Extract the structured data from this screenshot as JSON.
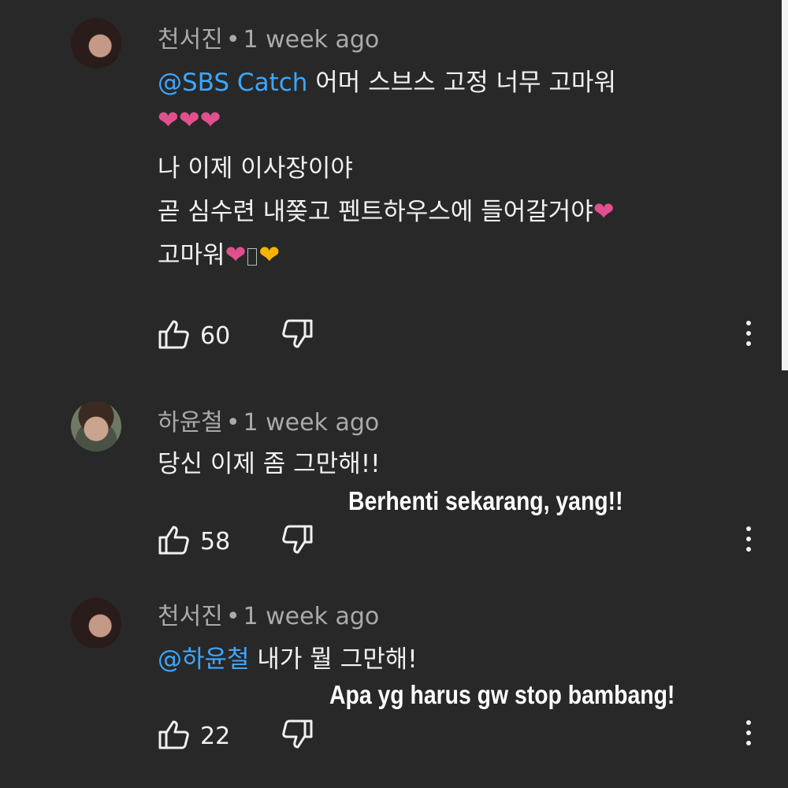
{
  "comments": [
    {
      "author": "천서진",
      "time": "1 week ago",
      "mention": "@SBS Catch",
      "text_line1": " 어머 스브스 고정 너무 고마워",
      "text_line3": "나 이제 이사장이야",
      "text_line4": "곧 심수련 내쫒고 펜트하우스에 들어갈거야",
      "text_line5": "고마워",
      "likes": "60"
    },
    {
      "author": "하윤철",
      "time": "1 week ago",
      "text_line1": "당신 이제 좀 그만해!!",
      "caption": "Berhenti sekarang, yang!!",
      "likes": "58"
    },
    {
      "author": "천서진",
      "time": "1 week ago",
      "mention": "@하윤철",
      "text_line1": " 내가 뭘 그만해!",
      "caption": "Apa yg harus gw stop bambang!",
      "likes": "22"
    }
  ],
  "colors": {
    "background": "#282828",
    "mention": "#3ea6ff",
    "heart_pink": "#e0508d",
    "heart_gold": "#f7b500"
  },
  "icons": [
    "thumb-up-icon",
    "thumb-down-icon",
    "more-vert-icon",
    "heart-icon"
  ]
}
